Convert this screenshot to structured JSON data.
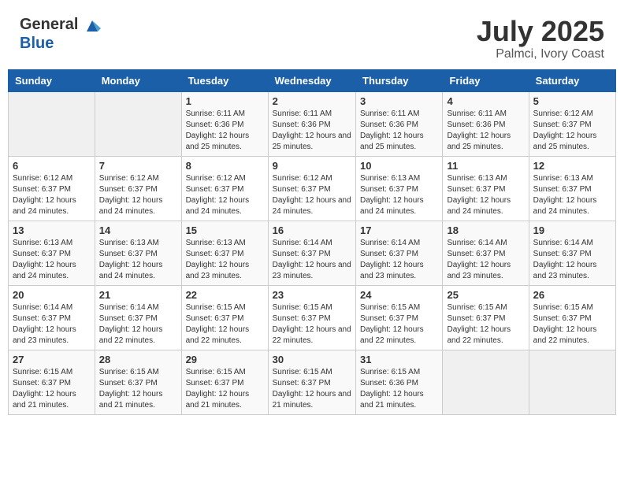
{
  "header": {
    "logo_general": "General",
    "logo_blue": "Blue",
    "title": "July 2025",
    "location": "Palmci, Ivory Coast"
  },
  "days_of_week": [
    "Sunday",
    "Monday",
    "Tuesday",
    "Wednesday",
    "Thursday",
    "Friday",
    "Saturday"
  ],
  "weeks": [
    [
      {
        "day": "",
        "empty": true
      },
      {
        "day": "",
        "empty": true
      },
      {
        "day": "1",
        "sunrise": "Sunrise: 6:11 AM",
        "sunset": "Sunset: 6:36 PM",
        "daylight": "Daylight: 12 hours and 25 minutes."
      },
      {
        "day": "2",
        "sunrise": "Sunrise: 6:11 AM",
        "sunset": "Sunset: 6:36 PM",
        "daylight": "Daylight: 12 hours and 25 minutes."
      },
      {
        "day": "3",
        "sunrise": "Sunrise: 6:11 AM",
        "sunset": "Sunset: 6:36 PM",
        "daylight": "Daylight: 12 hours and 25 minutes."
      },
      {
        "day": "4",
        "sunrise": "Sunrise: 6:11 AM",
        "sunset": "Sunset: 6:36 PM",
        "daylight": "Daylight: 12 hours and 25 minutes."
      },
      {
        "day": "5",
        "sunrise": "Sunrise: 6:12 AM",
        "sunset": "Sunset: 6:37 PM",
        "daylight": "Daylight: 12 hours and 25 minutes."
      }
    ],
    [
      {
        "day": "6",
        "sunrise": "Sunrise: 6:12 AM",
        "sunset": "Sunset: 6:37 PM",
        "daylight": "Daylight: 12 hours and 24 minutes."
      },
      {
        "day": "7",
        "sunrise": "Sunrise: 6:12 AM",
        "sunset": "Sunset: 6:37 PM",
        "daylight": "Daylight: 12 hours and 24 minutes."
      },
      {
        "day": "8",
        "sunrise": "Sunrise: 6:12 AM",
        "sunset": "Sunset: 6:37 PM",
        "daylight": "Daylight: 12 hours and 24 minutes."
      },
      {
        "day": "9",
        "sunrise": "Sunrise: 6:12 AM",
        "sunset": "Sunset: 6:37 PM",
        "daylight": "Daylight: 12 hours and 24 minutes."
      },
      {
        "day": "10",
        "sunrise": "Sunrise: 6:13 AM",
        "sunset": "Sunset: 6:37 PM",
        "daylight": "Daylight: 12 hours and 24 minutes."
      },
      {
        "day": "11",
        "sunrise": "Sunrise: 6:13 AM",
        "sunset": "Sunset: 6:37 PM",
        "daylight": "Daylight: 12 hours and 24 minutes."
      },
      {
        "day": "12",
        "sunrise": "Sunrise: 6:13 AM",
        "sunset": "Sunset: 6:37 PM",
        "daylight": "Daylight: 12 hours and 24 minutes."
      }
    ],
    [
      {
        "day": "13",
        "sunrise": "Sunrise: 6:13 AM",
        "sunset": "Sunset: 6:37 PM",
        "daylight": "Daylight: 12 hours and 24 minutes."
      },
      {
        "day": "14",
        "sunrise": "Sunrise: 6:13 AM",
        "sunset": "Sunset: 6:37 PM",
        "daylight": "Daylight: 12 hours and 24 minutes."
      },
      {
        "day": "15",
        "sunrise": "Sunrise: 6:13 AM",
        "sunset": "Sunset: 6:37 PM",
        "daylight": "Daylight: 12 hours and 23 minutes."
      },
      {
        "day": "16",
        "sunrise": "Sunrise: 6:14 AM",
        "sunset": "Sunset: 6:37 PM",
        "daylight": "Daylight: 12 hours and 23 minutes."
      },
      {
        "day": "17",
        "sunrise": "Sunrise: 6:14 AM",
        "sunset": "Sunset: 6:37 PM",
        "daylight": "Daylight: 12 hours and 23 minutes."
      },
      {
        "day": "18",
        "sunrise": "Sunrise: 6:14 AM",
        "sunset": "Sunset: 6:37 PM",
        "daylight": "Daylight: 12 hours and 23 minutes."
      },
      {
        "day": "19",
        "sunrise": "Sunrise: 6:14 AM",
        "sunset": "Sunset: 6:37 PM",
        "daylight": "Daylight: 12 hours and 23 minutes."
      }
    ],
    [
      {
        "day": "20",
        "sunrise": "Sunrise: 6:14 AM",
        "sunset": "Sunset: 6:37 PM",
        "daylight": "Daylight: 12 hours and 23 minutes."
      },
      {
        "day": "21",
        "sunrise": "Sunrise: 6:14 AM",
        "sunset": "Sunset: 6:37 PM",
        "daylight": "Daylight: 12 hours and 22 minutes."
      },
      {
        "day": "22",
        "sunrise": "Sunrise: 6:15 AM",
        "sunset": "Sunset: 6:37 PM",
        "daylight": "Daylight: 12 hours and 22 minutes."
      },
      {
        "day": "23",
        "sunrise": "Sunrise: 6:15 AM",
        "sunset": "Sunset: 6:37 PM",
        "daylight": "Daylight: 12 hours and 22 minutes."
      },
      {
        "day": "24",
        "sunrise": "Sunrise: 6:15 AM",
        "sunset": "Sunset: 6:37 PM",
        "daylight": "Daylight: 12 hours and 22 minutes."
      },
      {
        "day": "25",
        "sunrise": "Sunrise: 6:15 AM",
        "sunset": "Sunset: 6:37 PM",
        "daylight": "Daylight: 12 hours and 22 minutes."
      },
      {
        "day": "26",
        "sunrise": "Sunrise: 6:15 AM",
        "sunset": "Sunset: 6:37 PM",
        "daylight": "Daylight: 12 hours and 22 minutes."
      }
    ],
    [
      {
        "day": "27",
        "sunrise": "Sunrise: 6:15 AM",
        "sunset": "Sunset: 6:37 PM",
        "daylight": "Daylight: 12 hours and 21 minutes."
      },
      {
        "day": "28",
        "sunrise": "Sunrise: 6:15 AM",
        "sunset": "Sunset: 6:37 PM",
        "daylight": "Daylight: 12 hours and 21 minutes."
      },
      {
        "day": "29",
        "sunrise": "Sunrise: 6:15 AM",
        "sunset": "Sunset: 6:37 PM",
        "daylight": "Daylight: 12 hours and 21 minutes."
      },
      {
        "day": "30",
        "sunrise": "Sunrise: 6:15 AM",
        "sunset": "Sunset: 6:37 PM",
        "daylight": "Daylight: 12 hours and 21 minutes."
      },
      {
        "day": "31",
        "sunrise": "Sunrise: 6:15 AM",
        "sunset": "Sunset: 6:36 PM",
        "daylight": "Daylight: 12 hours and 21 minutes."
      },
      {
        "day": "",
        "empty": true
      },
      {
        "day": "",
        "empty": true
      }
    ]
  ]
}
